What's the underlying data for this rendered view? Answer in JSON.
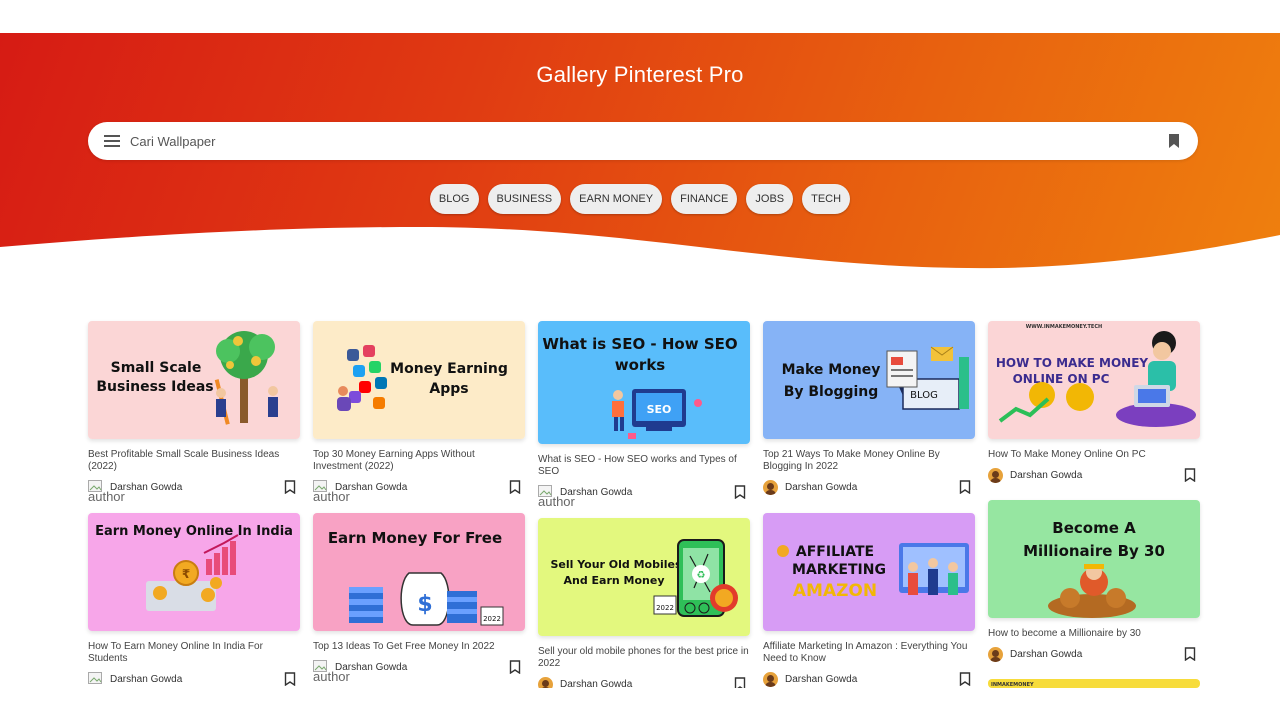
{
  "app": {
    "title": "Gallery Pinterest Pro"
  },
  "search": {
    "placeholder": "Cari Wallpaper"
  },
  "categories": [
    "BLOG",
    "BUSINESS",
    "EARN MONEY",
    "FINANCE",
    "JOBS",
    "TECH"
  ],
  "author_alt": "author",
  "posts": [
    {
      "title": "Best Profitable Small Scale Business Ideas (2022)",
      "author": "Darshan Gowda",
      "thumb_text": "Small Scale Business Ideas",
      "bg": "#fbd6d6"
    },
    {
      "title": "Top 30 Money Earning Apps Without Investment (2022)",
      "author": "Darshan Gowda",
      "thumb_text": "Money Earning Apps",
      "bg": "#fdebc8"
    },
    {
      "title": "What is SEO - How SEO works and Types of SEO",
      "author": "Darshan Gowda",
      "thumb_text": "What is SEO - How SEO works",
      "bg": "#59bdfb"
    },
    {
      "title": "Top 21 Ways To Make Money Online By Blogging In 2022",
      "author": "Darshan Gowda",
      "thumb_text": "Make Money By Blogging",
      "bg": "#86b3f6"
    },
    {
      "title": "How To Make Money Online On PC",
      "author": "Darshan Gowda",
      "thumb_text": "HOW TO MAKE MONEY ONLINE ON PC",
      "thumb_small": "WWW.INMAKEMONEY.TECH",
      "bg": "#fbd5d6"
    },
    {
      "title": "How To Earn Money Online In India For Students",
      "author": "Darshan Gowda",
      "thumb_text": "Earn Money Online In India",
      "bg": "#f7a6e9"
    },
    {
      "title": "Top 13 Ideas To Get Free Money In 2022",
      "author": "Darshan Gowda",
      "thumb_text": "Earn Money For Free",
      "bg": "#f8a2c4"
    },
    {
      "title": "Sell your old mobile phones for the best price in 2022",
      "author": "Darshan Gowda",
      "thumb_text": "Sell Your Old Mobiles And Earn Money",
      "bg": "#e3f87e"
    },
    {
      "title": "Affiliate Marketing In Amazon : Everything You Need to Know",
      "author": "Darshan Gowda",
      "thumb_text": "AFFILIATE MARKETING AMAZON",
      "bg": "#d79cf5"
    },
    {
      "title": "How to become a Millionaire by 30",
      "author": "Darshan Gowda",
      "thumb_text": "Become A Millionaire By 30",
      "bg": "#96e6a1"
    },
    {
      "title": "",
      "author": "",
      "thumb_text": "",
      "thumb_small": "INMAKEMONEY",
      "bg": "#f7dc3b"
    }
  ],
  "colors": {
    "header_start": "#d61b14",
    "header_end": "#ef800e",
    "chip_bg": "#eeeeee"
  },
  "icons": {
    "menu": "menu-icon",
    "bookmark": "bookmark-icon",
    "save": "bookmark-outline-icon"
  }
}
